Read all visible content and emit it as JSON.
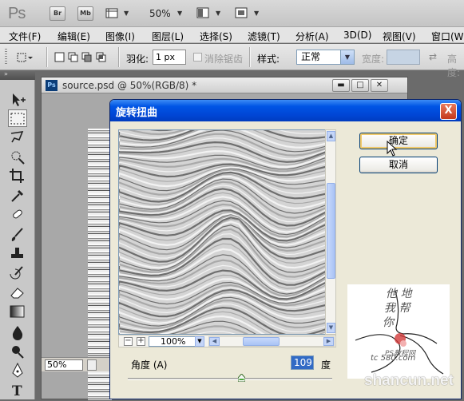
{
  "appbar": {
    "logo": "Ps",
    "bridge": "Br",
    "minibridge": "Mb",
    "zoom": "50%"
  },
  "menu": [
    "文件(F)",
    "编辑(E)",
    "图像(I)",
    "图层(L)",
    "选择(S)",
    "滤镜(T)",
    "分析(A)",
    "3D(D)",
    "视图(V)",
    "窗口(W)"
  ],
  "options": {
    "feather_label": "羽化:",
    "feather_value": "1 px",
    "antialias_label": "消除锯齿",
    "style_label": "样式:",
    "style_value": "正常",
    "width_label": "宽度:",
    "height_label": "高度:"
  },
  "document": {
    "title": "source.psd @ 50%(RGB/8) *",
    "icon": "Ps",
    "status_zoom": "50%"
  },
  "dialog": {
    "title": "旋转扭曲",
    "close": "X",
    "ok": "确定",
    "cancel": "取消",
    "zoom": "100%",
    "zoom_minus": "−",
    "zoom_plus": "+",
    "angle_label": "角度 (A)",
    "angle_value": "109",
    "angle_unit": "度",
    "angle_min": -999,
    "angle_max": 999
  },
  "watermark": {
    "line1": "PS教程网",
    "line2": "tc   580.com",
    "site": "shancun.net"
  }
}
